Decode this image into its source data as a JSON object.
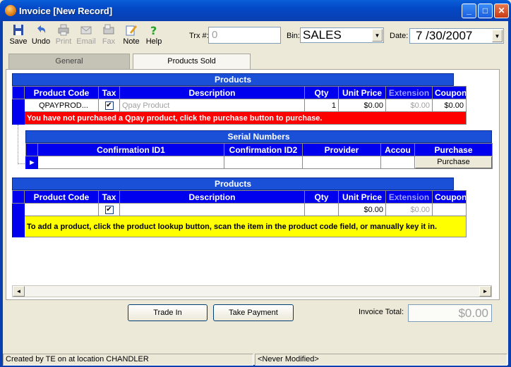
{
  "window": {
    "title": "Invoice [New Record]"
  },
  "toolbar": {
    "save": "Save",
    "undo": "Undo",
    "print": "Print",
    "email": "Email",
    "fax": "Fax",
    "note": "Note",
    "help": "Help"
  },
  "header": {
    "trx_label": "Trx #:",
    "trx_value": "0",
    "bin_label": "Bin:",
    "bin_value": "SALES",
    "date_label": "Date:",
    "date_value": "7 /30/2007"
  },
  "tabs": [
    {
      "label": "General"
    },
    {
      "label": "Products Sold"
    }
  ],
  "products_grid": {
    "caption": "Products",
    "columns": [
      "Product Code",
      "Tax",
      "Description",
      "Qty",
      "Unit Price",
      "Extension",
      "Coupon"
    ],
    "row": {
      "code": "QPAYPROD...",
      "tax_checked": "✔",
      "description": "Qpay Product",
      "qty": "1",
      "unit_price": "$0.00",
      "extension": "$0.00",
      "coupon": "$0.00"
    },
    "message": "You have not purchased a Qpay product, click the purchase button to purchase."
  },
  "serial_grid": {
    "caption": "Serial Numbers",
    "columns": [
      "Confirmation ID1",
      "Confirmation ID2",
      "Provider",
      "Accou",
      "Purchase"
    ],
    "purchase_button": "Purchase"
  },
  "new_product_grid": {
    "caption": "Products",
    "columns": [
      "Product Code",
      "Tax",
      "Description",
      "Qty",
      "Unit Price",
      "Extension",
      "Coupon"
    ],
    "row": {
      "code": "",
      "tax_checked": "✔",
      "description": "",
      "qty": "",
      "unit_price": "$0.00",
      "extension": "$0.00",
      "coupon": ""
    },
    "message": "To add a product, click the product lookup button, scan the item in the product code field, or manually key it in."
  },
  "buttons": {
    "trade_in": "Trade In",
    "take_payment": "Take Payment"
  },
  "invoice_total": {
    "label": "Invoice Total:",
    "value": "$0.00"
  },
  "status_bar": {
    "left": "Created by TE on  at location CHANDLER",
    "right": "<Never Modified>"
  }
}
